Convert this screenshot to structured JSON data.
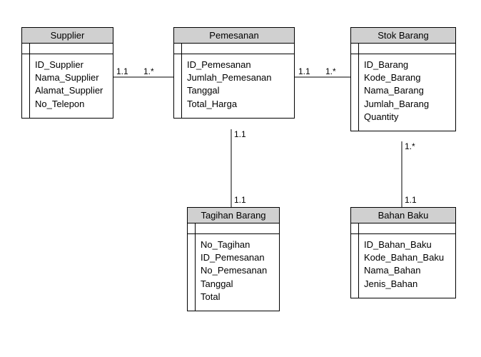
{
  "classes": {
    "supplier": {
      "title": "Supplier",
      "attrs": [
        "ID_Supplier",
        "Nama_Supplier",
        "Alamat_Supplier",
        "No_Telepon"
      ]
    },
    "pemesanan": {
      "title": "Pemesanan",
      "attrs": [
        "ID_Pemesanan",
        "Jumlah_Pemesanan",
        "Tanggal",
        "Total_Harga"
      ]
    },
    "stok_barang": {
      "title": "Stok Barang",
      "attrs": [
        "ID_Barang",
        "Kode_Barang",
        "Nama_Barang",
        "Jumlah_Barang",
        "Quantity"
      ]
    },
    "tagihan": {
      "title": "Tagihan Barang",
      "attrs": [
        "No_Tagihan",
        "ID_Pemesanan",
        "No_Pemesanan",
        "Tanggal",
        "Total"
      ]
    },
    "bahan_baku": {
      "title": "Bahan Baku",
      "attrs": [
        "ID_Bahan_Baku",
        "Kode_Bahan_Baku",
        "Nama_Bahan",
        "Jenis_Bahan"
      ]
    }
  },
  "multiplicities": {
    "supplier_pemesanan_left": "1.1",
    "supplier_pemesanan_right": "1.*",
    "pemesanan_stok_left": "1.1",
    "pemesanan_stok_right": "1.*",
    "pemesanan_tagihan_top": "1.1",
    "pemesanan_tagihan_bottom": "1.1",
    "stok_bahan_top": "1.*",
    "stok_bahan_bottom": "1.1"
  }
}
